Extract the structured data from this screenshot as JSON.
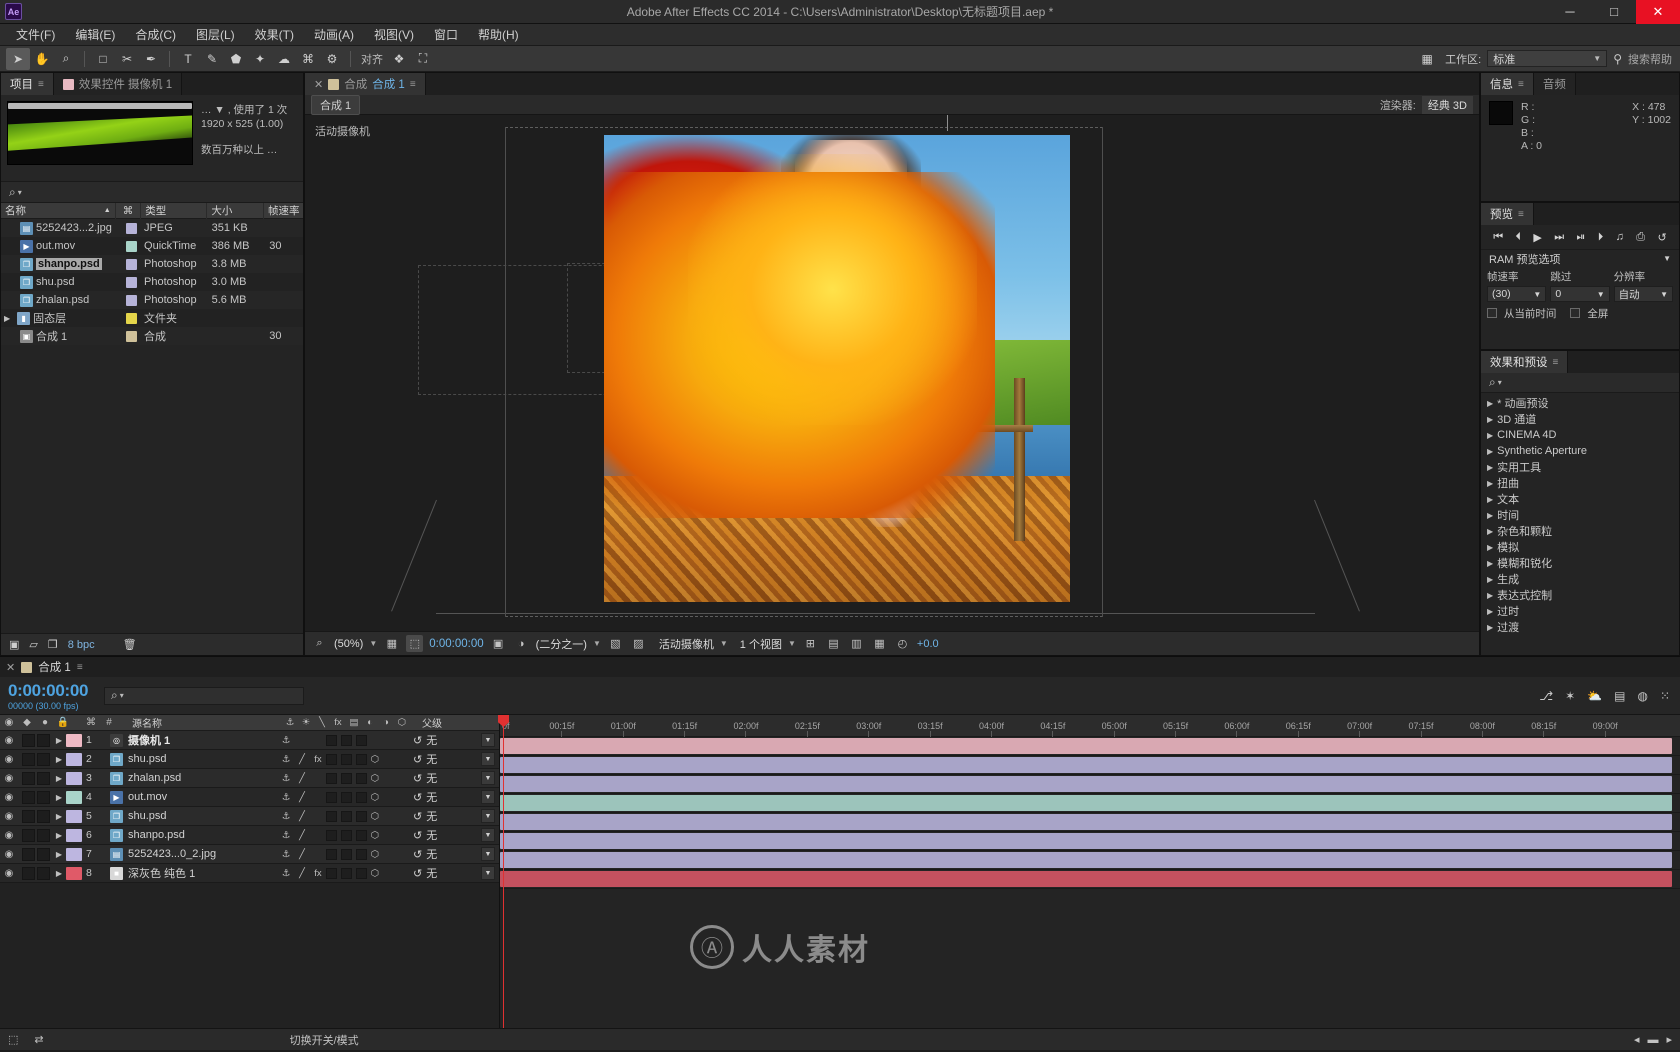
{
  "window": {
    "title": "Adobe After Effects CC 2014 - C:\\Users\\Administrator\\Desktop\\无标题项目.aep *",
    "logo": "Ae",
    "minimize": "─",
    "maximize": "□",
    "close": "✕"
  },
  "menubar": {
    "items": [
      "文件(F)",
      "编辑(E)",
      "合成(C)",
      "图层(L)",
      "效果(T)",
      "动画(A)",
      "视图(V)",
      "窗口",
      "帮助(H)"
    ]
  },
  "toolbar": {
    "tools": [
      "➤",
      "✋",
      "⌕",
      "□",
      "✂",
      "✒",
      "T",
      "✎",
      "⬟",
      "✦",
      "☁",
      "⌘",
      "⚙"
    ],
    "selected_index": 0,
    "snap_label": "对齐",
    "extra_tools": [
      "❖",
      "⛶"
    ],
    "workspace_label": "工作区:",
    "workspace_value": "标准",
    "workspace_caret": "▼",
    "search_icon": "⚲",
    "search_help": "搜索帮助"
  },
  "project": {
    "tabs": [
      {
        "label": "项目",
        "active": true,
        "menu": "≡"
      },
      {
        "label": "效果控件 摄像机 1",
        "active": false,
        "swatch": "#e8b9c2"
      }
    ],
    "meta_line1": "… ▼ , 使用了 1 次",
    "meta_line2": "1920 x 525 (1.00)",
    "meta_line3": "数百万种以上 …",
    "search_icon": "⌕",
    "columns": [
      "名称",
      "▲",
      "⌘",
      "类型",
      "大小",
      "帧速率"
    ],
    "rows": [
      {
        "name": "5252423...2.jpg",
        "type": "JPEG",
        "size": "351 KB",
        "fps": "",
        "color": "#b6b3d8",
        "icon": "#5d8fb5",
        "glyph": "▤",
        "selected": false,
        "folder": false
      },
      {
        "name": "out.mov",
        "type": "QuickTime",
        "size": "386 MB",
        "fps": "30",
        "color": "#a9d4c9",
        "icon": "#4a72a8",
        "glyph": "▶",
        "selected": false,
        "folder": false
      },
      {
        "name": "shanpo.psd",
        "type": "Photoshop",
        "size": "3.8 MB",
        "fps": "",
        "color": "#b6b3d8",
        "icon": "#6fa8c8",
        "glyph": "❐",
        "selected": true,
        "folder": false
      },
      {
        "name": "shu.psd",
        "type": "Photoshop",
        "size": "3.0 MB",
        "fps": "",
        "color": "#b6b3d8",
        "icon": "#6fa8c8",
        "glyph": "❐",
        "selected": false,
        "folder": false
      },
      {
        "name": "zhalan.psd",
        "type": "Photoshop",
        "size": "5.6 MB",
        "fps": "",
        "color": "#b6b3d8",
        "icon": "#6fa8c8",
        "glyph": "❐",
        "selected": false,
        "folder": false
      },
      {
        "name": "固态层",
        "type": "文件夹",
        "size": "",
        "fps": "",
        "color": "#e4d54a",
        "icon": "#7fa6c8",
        "glyph": "▮",
        "selected": false,
        "folder": true
      },
      {
        "name": "合成 1",
        "type": "合成",
        "size": "",
        "fps": "30",
        "color": "#cfc19a",
        "icon": "#8a8a8a",
        "glyph": "▣",
        "selected": false,
        "folder": false
      }
    ],
    "footer": {
      "new_comp_icon": "▣",
      "new_folder_icon": "▱",
      "frame_icon": "❐",
      "bpc": "8 bpc",
      "delete_icon": "Ὕ1"
    }
  },
  "composition": {
    "tabs": [
      {
        "label": "✕",
        "kind": "close"
      },
      {
        "label": "合成",
        "kind": "crumb"
      },
      {
        "label": "合成 1",
        "kind": "active"
      },
      {
        "label": "≡",
        "kind": "menu"
      }
    ],
    "chip_label": "合成 1",
    "renderer_label": "渲染器:",
    "renderer_value": "经典 3D",
    "camera_label": "活动摄像机",
    "toolbar": {
      "magnify_icon": "⌕",
      "zoom_value": "(50%)",
      "zoom_caret": "▼",
      "grid_icon": "▦",
      "mask_icon": "⬚",
      "time_value": "0:00:00:00",
      "snapshot_icon": "▣",
      "channel_icon": "◑",
      "resolution_value": "(二分之一)",
      "resolution_caret": "▼",
      "roi_icon": "▧",
      "transparency_icon": "▨",
      "view_value": "活动摄像机",
      "view_caret": "▼",
      "views_value": "1 个视图",
      "views_caret": "▼",
      "toggle_icons": [
        "⊞",
        "▤",
        "▥",
        "▦",
        "▧"
      ],
      "timeclock_icon": "◴",
      "exposure_value": "+0.0"
    }
  },
  "info": {
    "tabs": [
      {
        "label": "信息",
        "active": true,
        "menu": "≡"
      },
      {
        "label": "音频",
        "active": false
      }
    ],
    "r": "R :",
    "g": "G :",
    "b": "B :",
    "a": "A : 0",
    "plus": "+",
    "x": "X : 478",
    "y": "Y : 1002"
  },
  "preview": {
    "tabs": [
      {
        "label": "预览",
        "active": true,
        "menu": "≡"
      }
    ],
    "transport": [
      "⏮",
      "⏴",
      "▶",
      "⏭",
      "⏯",
      "⏵",
      "♫",
      "⎙",
      "↺"
    ],
    "ram_label": "RAM 预览选项",
    "ram_caret": "▼",
    "fields": [
      {
        "label": "帧速率",
        "value": "(30)",
        "caret": "▼"
      },
      {
        "label": "跳过",
        "value": "0",
        "caret": "▼"
      },
      {
        "label": "分辨率",
        "value": "自动",
        "caret": "▼"
      }
    ],
    "checks": [
      {
        "label": "从当前时间",
        "checked": false
      },
      {
        "label": "全屏",
        "checked": false
      }
    ]
  },
  "effects": {
    "tabs": [
      {
        "label": "效果和预设",
        "active": true,
        "menu": "≡"
      }
    ],
    "search_icon": "⌕",
    "items": [
      "* 动画预设",
      "3D 通道",
      "CINEMA 4D",
      "Synthetic Aperture",
      "实用工具",
      "扭曲",
      "文本",
      "时间",
      "杂色和颗粒",
      "模拟",
      "模糊和锐化",
      "生成",
      "表达式控制",
      "过时",
      "过渡"
    ],
    "tri": "▶"
  },
  "timeline": {
    "tabs": [
      {
        "close": "✕",
        "swatch": "#cfc19a",
        "label": "合成 1",
        "menu": "≡"
      }
    ],
    "current_time": "0:00:00:00",
    "frame_info": "00000 (30.00 fps)",
    "search_icon": "⌕",
    "tools": [
      "⎇",
      "✶",
      "⛅",
      "▤",
      "◍",
      "⁙"
    ],
    "columns": {
      "eye": "◉",
      "audio": "◆",
      "solo": "●",
      "lock": "ὑ2",
      "tag": "⌘",
      "hash": "#",
      "source_name": "源名称",
      "switches": [
        "⚓",
        "☀",
        "╲",
        "fx",
        "▤",
        "◐",
        "◑",
        "⬡"
      ],
      "parent": "父级"
    },
    "layers": [
      {
        "num": "1",
        "name": "摄像机 1",
        "color": "#eeb9c4",
        "icon_color": "#3c3c3c",
        "glyph": "◎",
        "bold": true,
        "bar_color": "#d9a8b2",
        "parent": "无",
        "has_fx": false,
        "type": "camera"
      },
      {
        "num": "2",
        "name": "shu.psd",
        "color": "#bdb6e0",
        "icon_color": "#6fa8c8",
        "glyph": "❐",
        "bold": false,
        "bar_color": "#a8a4c8",
        "parent": "无",
        "has_fx": true,
        "type": "psd"
      },
      {
        "num": "3",
        "name": "zhalan.psd",
        "color": "#bdb6e0",
        "icon_color": "#6fa8c8",
        "glyph": "❐",
        "bold": false,
        "bar_color": "#a8a4c8",
        "parent": "无",
        "has_fx": false,
        "type": "psd"
      },
      {
        "num": "4",
        "name": "out.mov",
        "color": "#a9d4c9",
        "icon_color": "#4a72a8",
        "glyph": "▶",
        "bold": false,
        "bar_color": "#9cc4bb",
        "parent": "无",
        "has_fx": false,
        "type": "mov"
      },
      {
        "num": "5",
        "name": "shu.psd",
        "color": "#bdb6e0",
        "icon_color": "#6fa8c8",
        "glyph": "❐",
        "bold": false,
        "bar_color": "#a8a4c8",
        "parent": "无",
        "has_fx": false,
        "type": "psd"
      },
      {
        "num": "6",
        "name": "shanpo.psd",
        "color": "#bdb6e0",
        "icon_color": "#6fa8c8",
        "glyph": "❐",
        "bold": false,
        "bar_color": "#a8a4c8",
        "parent": "无",
        "has_fx": false,
        "type": "psd"
      },
      {
        "num": "7",
        "name": "5252423...0_2.jpg",
        "color": "#bdb6e0",
        "icon_color": "#5d8fb5",
        "glyph": "▤",
        "bold": false,
        "bar_color": "#a8a4c8",
        "parent": "无",
        "has_fx": false,
        "type": "jpg"
      },
      {
        "num": "8",
        "name": "深灰色 纯色 1",
        "color": "#e05a68",
        "icon_color": "#d8d8d8",
        "glyph": "■",
        "bold": false,
        "bar_color": "#c4515f",
        "parent": "无",
        "has_fx": true,
        "type": "solid"
      }
    ],
    "ruler_ticks": [
      "00:15f",
      "01:00f",
      "01:15f",
      "02:00f",
      "02:15f",
      "03:00f",
      "03:15f",
      "04:00f",
      "04:15f",
      "05:00f",
      "05:15f",
      "06:00f",
      "06:15f",
      "07:00f",
      "07:15f",
      "08:00f",
      "08:15f",
      "09:00f"
    ],
    "ruler_start": "0f",
    "footer": {
      "toggle_icon": "⬚",
      "graph_icon": "⇄",
      "switches_label": "切换开关/模式",
      "zoom_out": "◂",
      "zoom_in": "▸",
      "handle": "▬"
    }
  },
  "watermark": {
    "circle_glyph": "Ⓐ",
    "text": "人人素材"
  },
  "colors": {
    "accent_blue": "#4ea3e0",
    "cti_red": "#e03131",
    "panel_bg": "#242424",
    "header_bg": "#3a3a3a"
  }
}
